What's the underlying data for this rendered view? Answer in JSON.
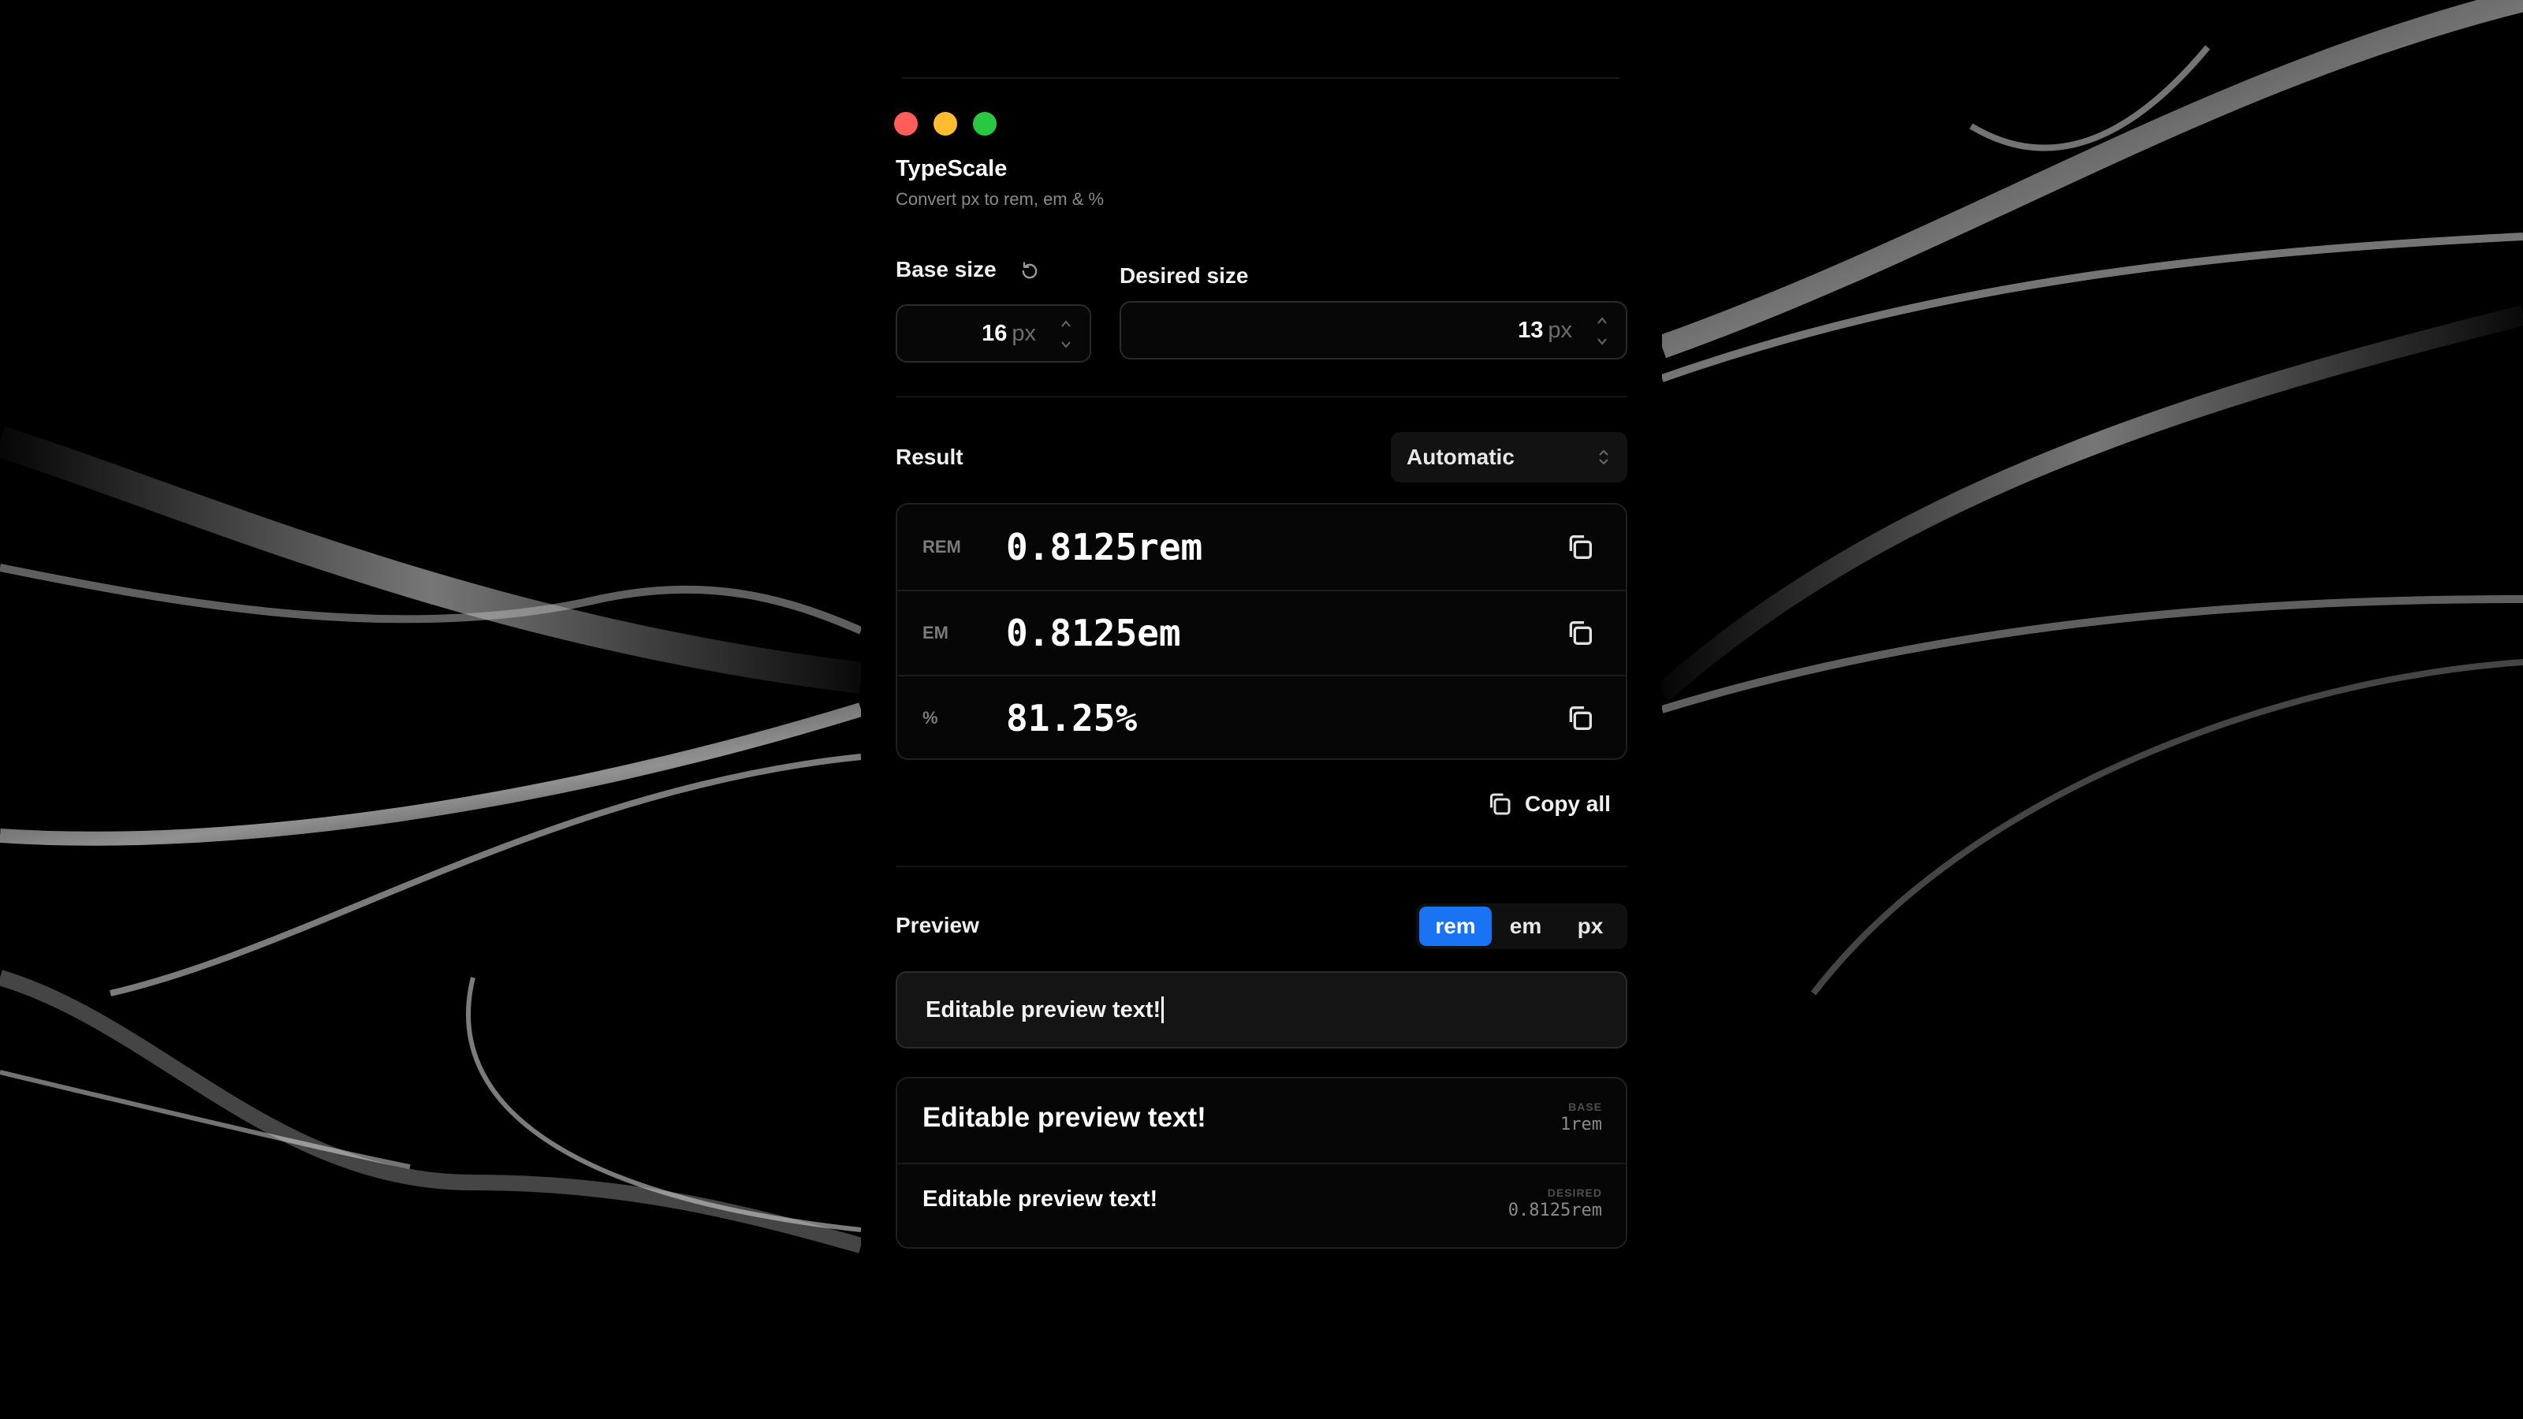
{
  "app": {
    "title": "TypeScale",
    "subtitle": "Convert px to rem, em & %"
  },
  "colors": {
    "close": "#ff5f57",
    "minimize": "#febc2e",
    "maximize": "#28c840",
    "accent": "#1a73f2"
  },
  "inputs": {
    "base_label": "Base size",
    "base_value": "16",
    "base_unit": "px",
    "desired_label": "Desired size",
    "desired_value": "13",
    "desired_unit": "px"
  },
  "result": {
    "label": "Result",
    "mode": "Automatic",
    "rows": [
      {
        "unit": "REM",
        "value": "0.8125rem"
      },
      {
        "unit": "EM",
        "value": "0.8125em"
      },
      {
        "unit": "%",
        "value": "81.25%"
      }
    ],
    "copy_all": "Copy all"
  },
  "preview": {
    "label": "Preview",
    "segments": [
      "rem",
      "em",
      "px"
    ],
    "active_segment": "rem",
    "input_text": "Editable preview text!",
    "samples": [
      {
        "text": "Editable preview text!",
        "tag": "BASE",
        "size": "1rem"
      },
      {
        "text": "Editable preview text!",
        "tag": "DESIRED",
        "size": "0.8125rem"
      }
    ]
  },
  "icons": {
    "reset": "reset-icon",
    "copy": "copy-icon",
    "chevron": "chevron-updown-icon"
  }
}
